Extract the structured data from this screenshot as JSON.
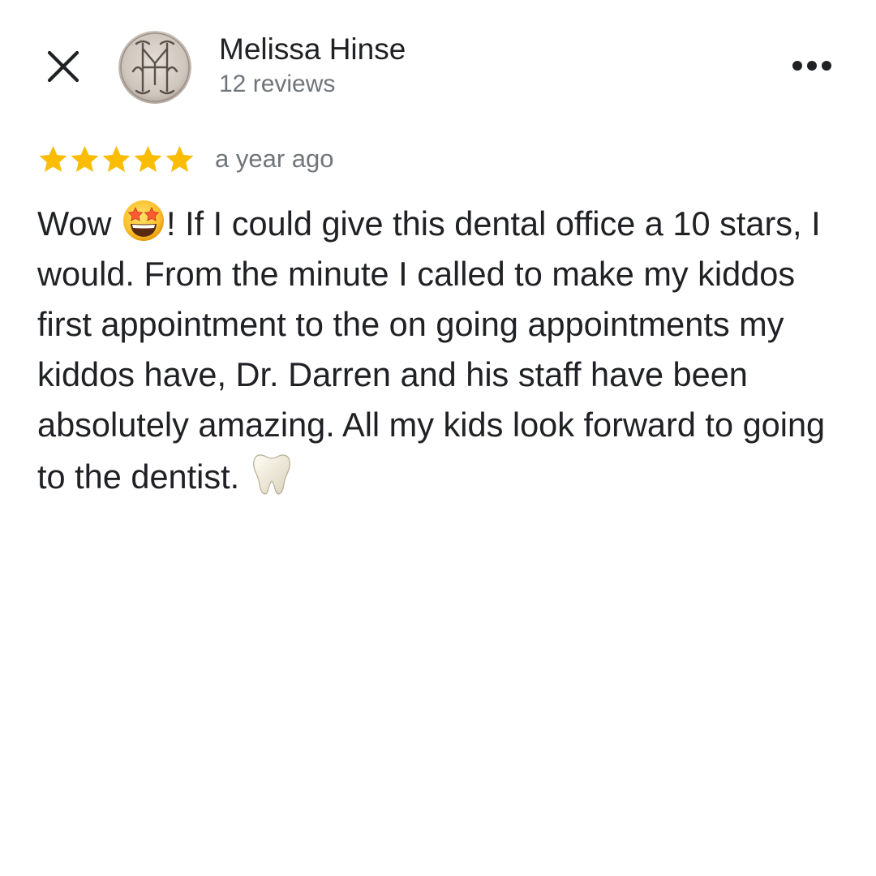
{
  "header": {
    "close_icon": "close-icon",
    "author_name": "Melissa Hinse",
    "review_count": "12 reviews",
    "avatar_icon": "monogram-avatar",
    "more_icon": "more-horizontal-icon"
  },
  "review": {
    "rating": 5,
    "rating_max": 5,
    "star_color": "#fbbc04",
    "date": "a year ago",
    "text_part1": "Wow ",
    "emoji1": "star-struck-emoji",
    "text_part2": "! If I could give this dental office a 10 stars, I would. From the minute I called to make my kiddos first appointment to the on going appointments my kiddos have, Dr. Darren and his staff have been absolutely amazing. All my kids look forward to going to the dentist. ",
    "emoji2": "tooth-emoji"
  },
  "colors": {
    "primary_text": "#202124",
    "secondary_text": "#70757a",
    "star": "#fbbc04"
  }
}
